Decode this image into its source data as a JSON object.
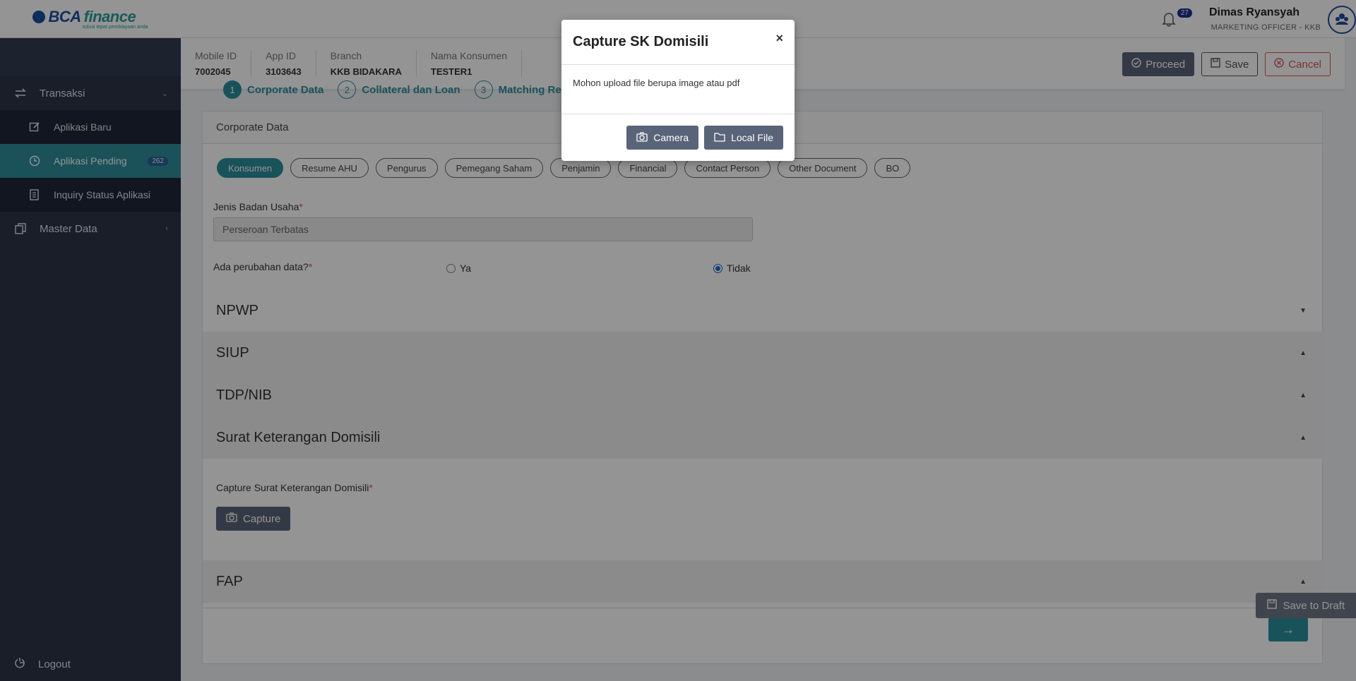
{
  "brand": {
    "logo_text_1": "BCA",
    "logo_text_2": "finance",
    "logo_tagline": "solusi tepat pembiayaan anda"
  },
  "header": {
    "notification_count": "27",
    "user_name": "Dimas Ryansyah",
    "user_role": "MARKETING OFFICER - KKB"
  },
  "sidebar": {
    "items": [
      {
        "label": "Transaksi",
        "icon": "swap-icon"
      },
      {
        "label": "Aplikasi Baru",
        "icon": "edit-icon"
      },
      {
        "label": "Aplikasi Pending",
        "icon": "clock-icon",
        "badge": "262"
      },
      {
        "label": "Inquiry Status Aplikasi",
        "icon": "document-icon"
      },
      {
        "label": "Master Data",
        "icon": "copy-icon"
      }
    ],
    "logout_label": "Logout"
  },
  "infobar": {
    "fields": [
      {
        "label": "Mobile ID",
        "value": "7002045"
      },
      {
        "label": "App ID",
        "value": "3103643"
      },
      {
        "label": "Branch",
        "value": "KKB BIDAKARA"
      },
      {
        "label": "Nama Konsumen",
        "value": "TESTER1"
      }
    ],
    "proceed_label": "Proceed",
    "save_label": "Save",
    "cancel_label": "Cancel"
  },
  "stepper": [
    {
      "num": "1",
      "label": "Corporate Data"
    },
    {
      "num": "2",
      "label": "Collateral dan Loan"
    },
    {
      "num": "3",
      "label": "Matching Res"
    }
  ],
  "card": {
    "title": "Corporate Data",
    "tabs": [
      "Konsumen",
      "Resume AHU",
      "Pengurus",
      "Pemegang Saham",
      "Penjamin",
      "Financial",
      "Contact Person",
      "Other Document",
      "BO"
    ],
    "jenis_label": "Jenis Badan Usaha",
    "jenis_value": "Perseroan Terbatas",
    "perubahan_label": "Ada perubahan data?",
    "radio_ya": "Ya",
    "radio_tidak": "Tidak",
    "sections": [
      "NPWP",
      "SIUP",
      "TDP/NIB",
      "Surat Keterangan Domisili",
      "FAP"
    ],
    "capture_label": "Capture Surat Keterangan Domisili",
    "capture_button": "Capture",
    "save_draft_label": "Save to Draft"
  },
  "modal": {
    "title": "Capture SK Domisili",
    "close": "×",
    "message": "Mohon upload file berupa image atau pdf",
    "camera_label": "Camera",
    "local_file_label": "Local File"
  }
}
